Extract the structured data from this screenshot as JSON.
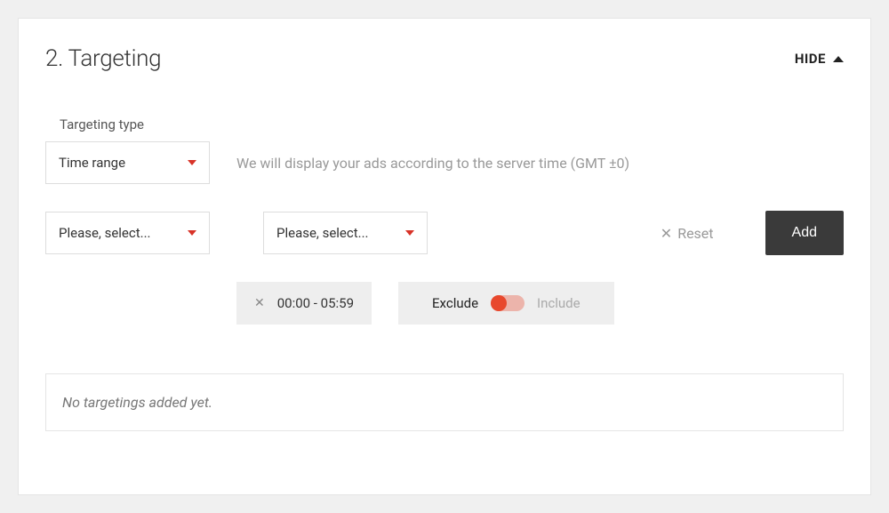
{
  "header": {
    "title": "2. Targeting",
    "hide_label": "HIDE"
  },
  "targeting_type": {
    "label": "Targeting type",
    "value": "Time range",
    "hint": "We will display your ads according to the server time (GMT ±0)"
  },
  "selectors": {
    "from_placeholder": "Please, select...",
    "to_placeholder": "Please, select..."
  },
  "actions": {
    "reset": "Reset",
    "add": "Add"
  },
  "chip": {
    "range": "00:00 - 05:59"
  },
  "toggle": {
    "left": "Exclude",
    "right": "Include",
    "state": "exclude"
  },
  "empty": "No targetings added yet."
}
